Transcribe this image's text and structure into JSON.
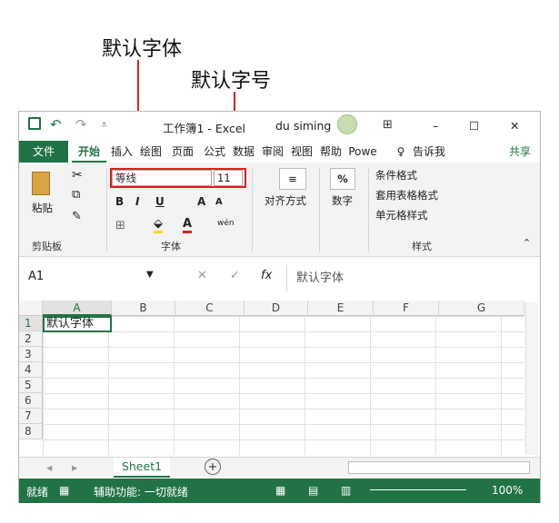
{
  "callouts": {
    "default_font": "默认字体",
    "default_size": "默认字号"
  },
  "titlebar": {
    "save_icon": "save-icon",
    "undo_icon": "undo-icon",
    "redo_icon": "redo-icon",
    "title": "工作簿1 - Excel",
    "user": "du siming",
    "min": "–",
    "max": "☐",
    "close": "✕"
  },
  "menu": {
    "tabs": [
      "文件",
      "开始",
      "插入",
      "绘图",
      "页面",
      "公式",
      "数据",
      "审阅",
      "视图",
      "帮助",
      "Powe"
    ],
    "tell_me": "告诉我",
    "share": "共享"
  },
  "ribbon": {
    "clipboard": {
      "paste": "粘贴",
      "label": "剪贴板"
    },
    "font": {
      "name": "等线",
      "size": "11",
      "bold": "B",
      "italic": "I",
      "underline": "U",
      "grow": "A",
      "shrink": "A",
      "label": "字体",
      "phonetic": "wén"
    },
    "align": {
      "label": "对齐方式"
    },
    "number": {
      "symbol": "%",
      "label": "数字"
    },
    "styles": {
      "conditional": "条件格式",
      "table": "套用表格格式",
      "cell": "单元格样式",
      "label": "样式"
    }
  },
  "formula": {
    "namebox": "A1",
    "cancel": "✕",
    "enter": "✓",
    "fx": "fx",
    "content": "默认字体"
  },
  "grid": {
    "columns": [
      "A",
      "B",
      "C",
      "D",
      "E",
      "F",
      "G"
    ],
    "rows": [
      "1",
      "2",
      "3",
      "4",
      "5",
      "6",
      "7",
      "8"
    ],
    "a1": "默认字体"
  },
  "sheets": {
    "active": "Sheet1",
    "add": "+"
  },
  "status": {
    "mode": "就绪",
    "accessibility": "辅助功能: 一切就绪",
    "zoom": "100%"
  },
  "colors": {
    "accent": "#217346",
    "callout": "#d9221c"
  }
}
